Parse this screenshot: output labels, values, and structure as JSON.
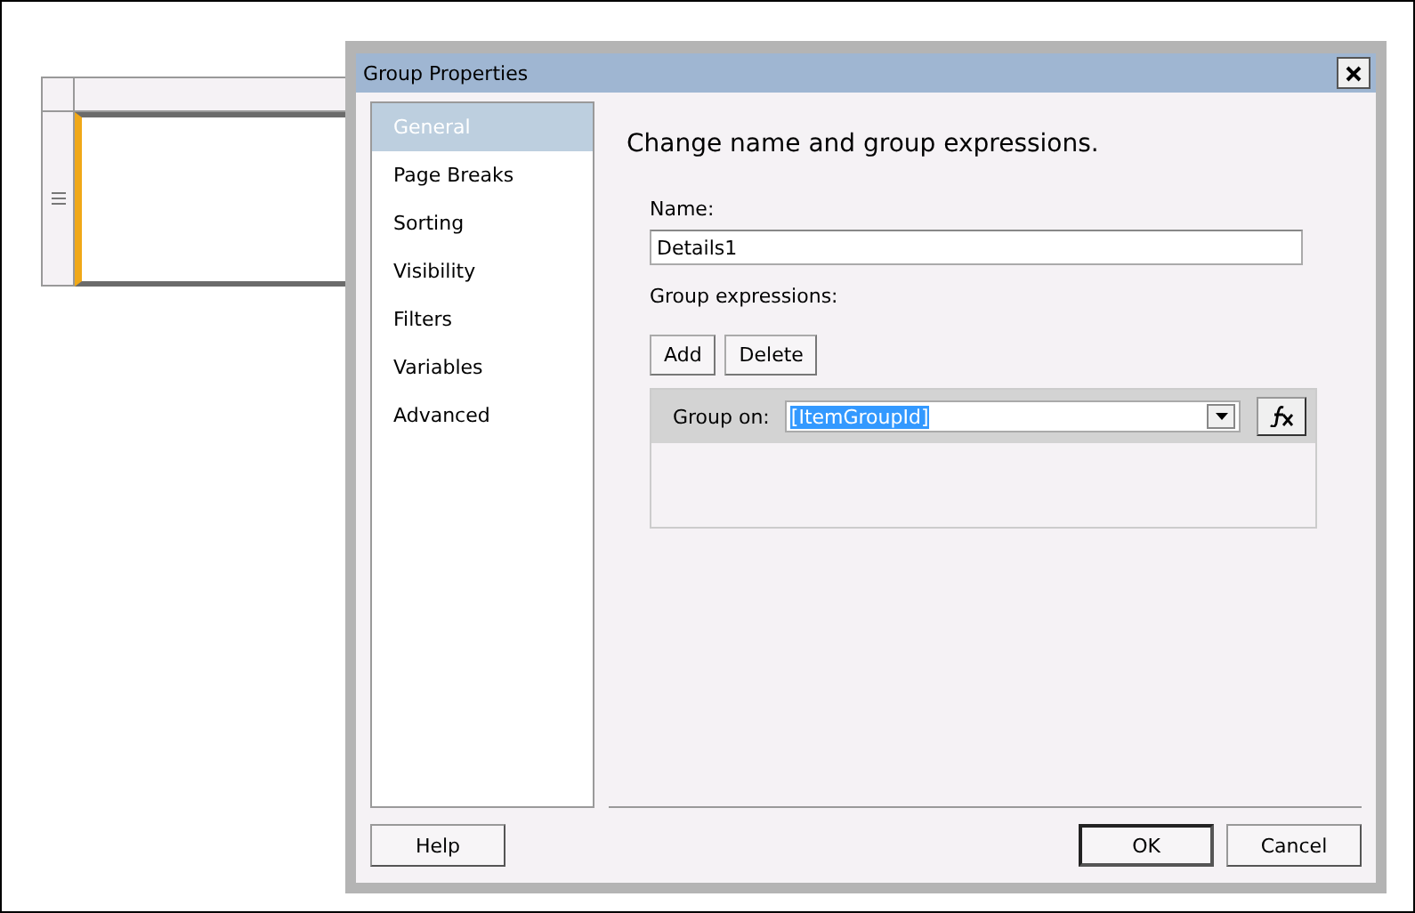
{
  "dialog": {
    "title": "Group Properties"
  },
  "nav": [
    {
      "label": "General",
      "selected": true
    },
    {
      "label": "Page Breaks",
      "selected": false
    },
    {
      "label": "Sorting",
      "selected": false
    },
    {
      "label": "Visibility",
      "selected": false
    },
    {
      "label": "Filters",
      "selected": false
    },
    {
      "label": "Variables",
      "selected": false
    },
    {
      "label": "Advanced",
      "selected": false
    }
  ],
  "heading": "Change name and group expressions.",
  "name_field": {
    "label": "Name:",
    "value": "Details1"
  },
  "group_expressions": {
    "label": "Group expressions:",
    "buttons": [
      "Add",
      "Delete"
    ],
    "rows": [
      {
        "label": "Group on:",
        "value": "[ItemGroupId]",
        "highlighted": true
      }
    ]
  },
  "footer": {
    "help": "Help",
    "buttons": [
      {
        "label": "OK",
        "default": true
      },
      {
        "label": "Cancel",
        "default": false
      }
    ]
  }
}
